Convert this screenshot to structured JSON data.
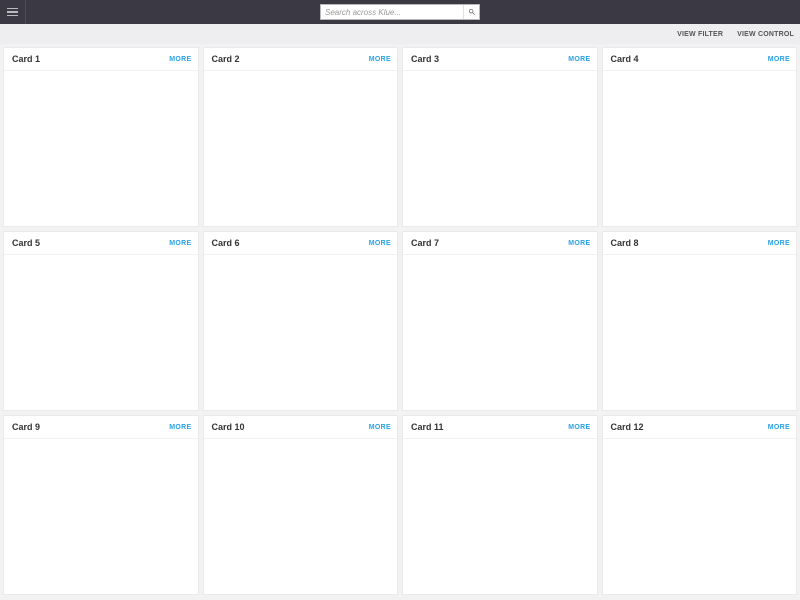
{
  "search": {
    "placeholder": "Search across Klue..."
  },
  "subbar": {
    "view_filter": "VIEW FILTER",
    "view_control": "VIEW CONTROL"
  },
  "more_label": "MORE",
  "cards": [
    {
      "title": "Card 1"
    },
    {
      "title": "Card 2"
    },
    {
      "title": "Card 3"
    },
    {
      "title": "Card 4"
    },
    {
      "title": "Card 5"
    },
    {
      "title": "Card 6"
    },
    {
      "title": "Card 7"
    },
    {
      "title": "Card 8"
    },
    {
      "title": "Card 9"
    },
    {
      "title": "Card 10"
    },
    {
      "title": "Card 11"
    },
    {
      "title": "Card 12"
    }
  ]
}
